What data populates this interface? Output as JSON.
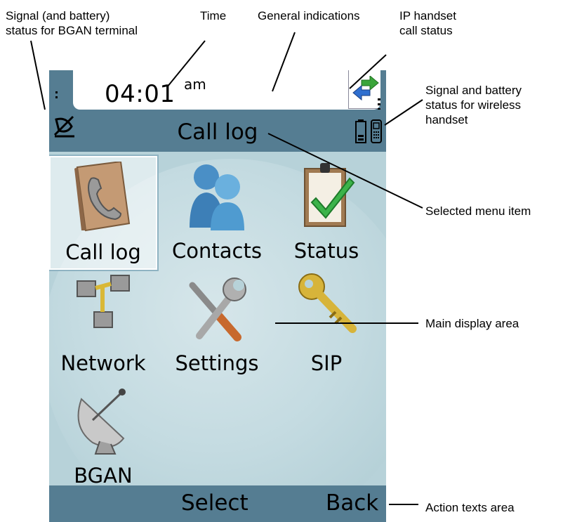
{
  "annotations": {
    "signal_bgan": "Signal (and battery)\nstatus for BGAN terminal",
    "time": "Time",
    "general": "General indications",
    "ip_handset": "IP handset\ncall status",
    "signal_wireless": "Signal and battery\nstatus for wireless\nhandset",
    "selected_menu_item": "Selected menu item",
    "main_display": "Main display area",
    "action_texts": "Action texts area"
  },
  "screen": {
    "time": "04:01",
    "am": "am",
    "title": "Call log",
    "menu": [
      {
        "label": "Call log",
        "icon": "phone-book-icon",
        "selected": true
      },
      {
        "label": "Contacts",
        "icon": "people-icon",
        "selected": false
      },
      {
        "label": "Status",
        "icon": "clipboard-check-icon",
        "selected": false
      },
      {
        "label": "Network",
        "icon": "network-icon",
        "selected": false
      },
      {
        "label": "Settings",
        "icon": "wrench-screwdriver-icon",
        "selected": false
      },
      {
        "label": "SIP",
        "icon": "key-icon",
        "selected": false
      },
      {
        "label": "BGAN",
        "icon": "satellite-dish-icon",
        "selected": false
      }
    ],
    "actions": {
      "select": "Select",
      "back": "Back"
    }
  },
  "colors": {
    "bar": "#557d92",
    "background": "#b7d2d9"
  }
}
